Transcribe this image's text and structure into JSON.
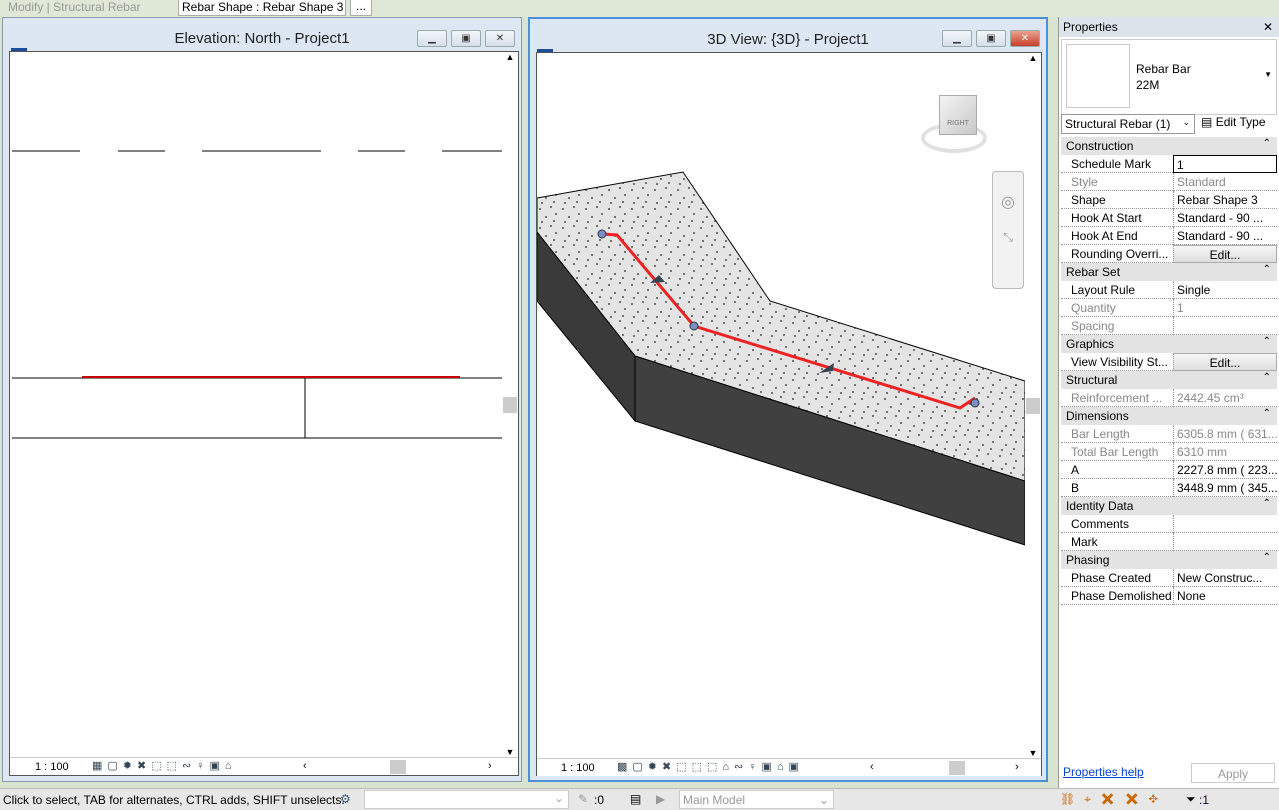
{
  "ribbon": {
    "context": "Modify | Structural Rebar",
    "type_selector": "Rebar Shape : Rebar Shape 3",
    "more": "..."
  },
  "elevation": {
    "title": "Elevation: North - Project1",
    "scale": "1 : 100",
    "icon": "revit-file-icon"
  },
  "view3d": {
    "title": "3D View: {3D} - Project1",
    "scale": "1 : 100",
    "viewcube_face": "RIGHT",
    "icon": "revit-file-icon"
  },
  "properties": {
    "title": "Properties",
    "close": "✕",
    "type_name": "Rebar Bar",
    "type_size": "22M",
    "filter": "Structural Rebar (1)",
    "edit_type": "Edit Type",
    "groups": [
      {
        "name": "Construction",
        "rows": [
          {
            "key": "Schedule Mark",
            "value": "1",
            "editable": true
          },
          {
            "key": "Style",
            "value": "Standard",
            "dim": true
          },
          {
            "key": "Shape",
            "value": "Rebar Shape 3"
          },
          {
            "key": "Hook At Start",
            "value": "Standard - 90 ..."
          },
          {
            "key": "Hook At End",
            "value": "Standard - 90 ..."
          },
          {
            "key": "Rounding Overri...",
            "value": "Edit...",
            "button": true
          }
        ]
      },
      {
        "name": "Rebar Set",
        "rows": [
          {
            "key": "Layout Rule",
            "value": "Single"
          },
          {
            "key": "Quantity",
            "value": "1",
            "dim": true
          },
          {
            "key": "Spacing",
            "value": "",
            "dim": true
          }
        ]
      },
      {
        "name": "Graphics",
        "rows": [
          {
            "key": "View Visibility St...",
            "value": "Edit...",
            "button": true
          }
        ]
      },
      {
        "name": "Structural",
        "rows": [
          {
            "key": "Reinforcement ...",
            "value": "2442.45 cm³",
            "dim": true
          }
        ]
      },
      {
        "name": "Dimensions",
        "rows": [
          {
            "key": "Bar Length",
            "value": "6305.8 mm ( 631...",
            "dim": true
          },
          {
            "key": "Total Bar Length",
            "value": "6310 mm",
            "dim": true
          },
          {
            "key": "A",
            "value": "2227.8 mm ( 223..."
          },
          {
            "key": "B",
            "value": "3448.9 mm ( 345..."
          }
        ]
      },
      {
        "name": "Identity Data",
        "rows": [
          {
            "key": "Comments",
            "value": ""
          },
          {
            "key": "Mark",
            "value": ""
          }
        ]
      },
      {
        "name": "Phasing",
        "rows": [
          {
            "key": "Phase Created",
            "value": "New Construc..."
          },
          {
            "key": "Phase Demolished",
            "value": "None"
          }
        ]
      }
    ],
    "help": "Properties help",
    "apply": "Apply"
  },
  "status": {
    "message": "Click to select, TAB for alternates, CTRL adds, SHIFT unselects.",
    "count": ":0",
    "model": "Main Model",
    "filter_count": ":1"
  },
  "colors": {
    "rebar": "#ee2222",
    "slab_top": "#e4e4e4",
    "slab_side": "#3c3c3c",
    "accent_link": "#0044cc"
  }
}
